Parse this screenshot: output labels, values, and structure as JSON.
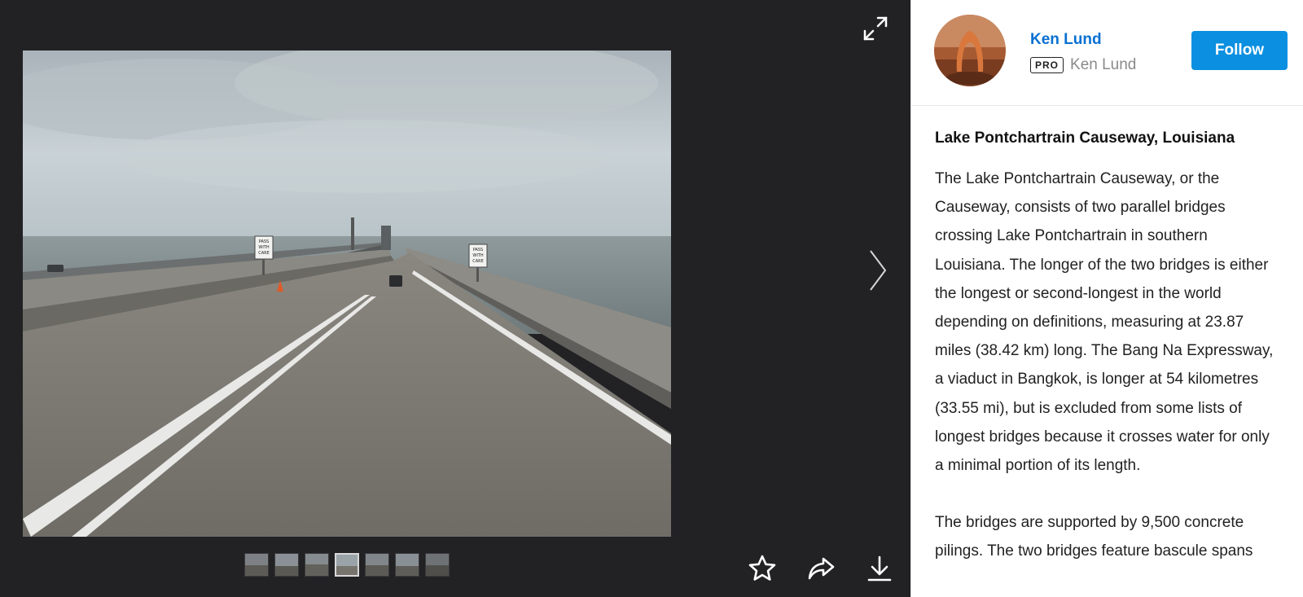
{
  "viewer": {
    "expand_icon": "expand-arrows-icon",
    "next_icon": "chevron-right-icon",
    "thumbnails": [
      {
        "name": "thumbnail-1"
      },
      {
        "name": "thumbnail-2"
      },
      {
        "name": "thumbnail-3"
      },
      {
        "name": "thumbnail-4",
        "active": true
      },
      {
        "name": "thumbnail-5"
      },
      {
        "name": "thumbnail-6"
      },
      {
        "name": "thumbnail-7"
      }
    ],
    "actions": [
      "star-icon",
      "share-icon",
      "download-icon"
    ]
  },
  "photo": {
    "sign_left": [
      "PASS",
      "WITH",
      "CARE"
    ],
    "sign_right": [
      "PASS",
      "WITH",
      "CARE"
    ]
  },
  "author": {
    "name": "Ken Lund",
    "badge": "PRO",
    "pro_name": "Ken Lund",
    "follow_label": "Follow"
  },
  "details": {
    "title": "Lake Pontchartrain Causeway, Louisiana",
    "paragraph_1": "The Lake Pontchartrain Causeway, or the Causeway, consists of two parallel bridges crossing Lake Pontchartrain in southern Louisiana. The longer of the two bridges is either the longest or second-longest in the world depending on definitions, measuring at 23.87 miles (38.42 km) long. The Bang Na Expressway, a viaduct in Bangkok, is longer at 54 kilometres (33.55 mi), but is excluded from some lists of longest bridges because it crosses water for only a minimal portion of its length.",
    "paragraph_2": "The bridges are supported by 9,500 concrete pilings. The two bridges feature bascule spans"
  },
  "colors": {
    "viewer_bg": "#222225",
    "link_blue": "#0870d1",
    "follow_blue": "#0b8fe0"
  }
}
